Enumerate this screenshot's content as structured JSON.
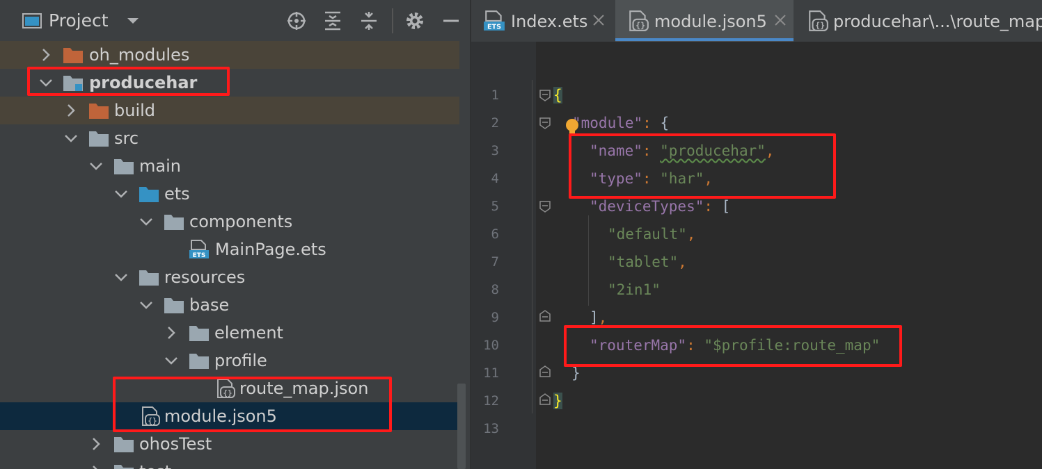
{
  "project_panel": {
    "title": "Project",
    "tree": [
      {
        "label": "oh_modules",
        "expanded": false,
        "icon": "folder-orange-icon"
      },
      {
        "label": "producehar",
        "expanded": true,
        "icon": "module-folder-icon"
      },
      {
        "label": "build",
        "expanded": false,
        "icon": "folder-orange-icon"
      },
      {
        "label": "src",
        "expanded": true,
        "icon": "folder-icon"
      },
      {
        "label": "main",
        "expanded": true,
        "icon": "folder-icon"
      },
      {
        "label": "ets",
        "expanded": true,
        "icon": "folder-blue-icon"
      },
      {
        "label": "components",
        "expanded": true,
        "icon": "folder-icon"
      },
      {
        "label": "MainPage.ets",
        "icon": "ets-file-icon"
      },
      {
        "label": "resources",
        "expanded": true,
        "icon": "folder-icon"
      },
      {
        "label": "base",
        "expanded": true,
        "icon": "folder-icon"
      },
      {
        "label": "element",
        "expanded": false,
        "icon": "folder-icon"
      },
      {
        "label": "profile",
        "expanded": true,
        "icon": "folder-icon"
      },
      {
        "label": "route_map.json",
        "icon": "json-file-icon"
      },
      {
        "label": "module.json5",
        "icon": "json-file-icon",
        "selected": true
      },
      {
        "label": "ohosTest",
        "expanded": false,
        "icon": "folder-icon"
      },
      {
        "label": "test",
        "expanded": false,
        "icon": "folder-icon"
      }
    ]
  },
  "tabs": [
    {
      "label": "Index.ets",
      "icon": "ets-file-icon",
      "active": false
    },
    {
      "label": "module.json5",
      "icon": "json-file-icon",
      "active": true
    },
    {
      "label": "producehar\\...\\route_map.j",
      "icon": "json-file-icon",
      "active": false
    }
  ],
  "editor": {
    "line_numbers": [
      "1",
      "2",
      "3",
      "4",
      "5",
      "6",
      "7",
      "8",
      "9",
      "10",
      "11",
      "12",
      "13"
    ],
    "code": {
      "l1_brace": "{",
      "l2_key": "\"module\"",
      "l2_rest_colon": ": ",
      "l2_brace": "{",
      "l3_key": "\"name\"",
      "l3_colon": ": ",
      "l3_val": "\"producehar\"",
      "l3_comma": ",",
      "l4_key": "\"type\"",
      "l4_colon": ": ",
      "l4_val": "\"har\"",
      "l4_comma": ",",
      "l5_key": "\"deviceTypes\"",
      "l5_colon": ": ",
      "l5_bracket": "[",
      "l6_val": "\"default\"",
      "l6_comma": ",",
      "l7_val": "\"tablet\"",
      "l7_comma": ",",
      "l8_val": "\"2in1\"",
      "l9_bracket": "]",
      "l9_comma": ",",
      "l10_key": "\"routerMap\"",
      "l10_colon": ": ",
      "l10_val": "\"$profile:route_map\"",
      "l11_brace": "}",
      "l12_brace": "}"
    }
  },
  "colors": {
    "highlight_box": "#ff1a1a",
    "key": "#9876aa",
    "string": "#6a8759",
    "punctuation": "#cc7832",
    "selection": "#0d293e"
  }
}
